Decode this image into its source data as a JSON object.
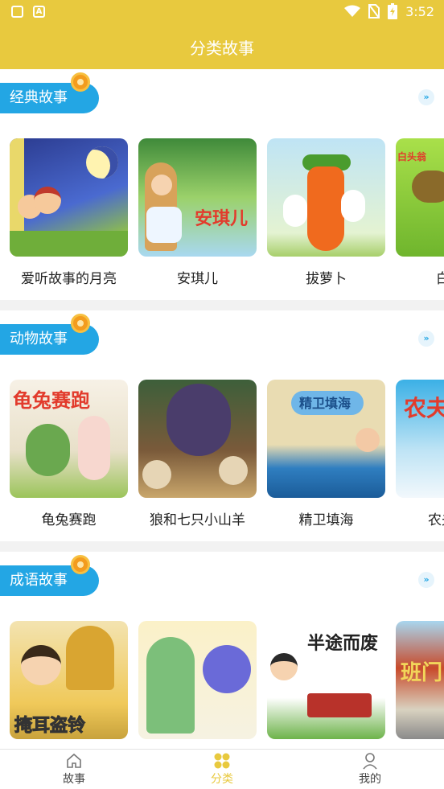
{
  "status_bar": {
    "time": "3:52"
  },
  "header": {
    "title": "分类故事"
  },
  "sections": [
    {
      "title": "经典故事",
      "items": [
        "爱听故事的月亮",
        "安琪儿",
        "拔萝卜",
        "白"
      ]
    },
    {
      "title": "动物故事",
      "items": [
        "龟兔赛跑",
        "狼和七只小山羊",
        "精卫填海",
        "农夫"
      ]
    },
    {
      "title": "成语故事",
      "items": [
        "掩耳盗铃",
        "",
        "",
        ""
      ]
    }
  ],
  "thumb_titles": {
    "anqier": "安琪儿",
    "guitu": "龟兔赛跑",
    "jingwei": "精卫填海",
    "nong": "农夫",
    "bai": "白头翁",
    "yanerdaoling": "掩耳盗铃",
    "bantu": "半途而废",
    "banmen": "班门"
  },
  "nav": {
    "items": [
      "故事",
      "分类",
      "我的"
    ],
    "active": "分类"
  },
  "colors": {
    "accent": "#e8c93e",
    "pill": "#23a6e4"
  }
}
